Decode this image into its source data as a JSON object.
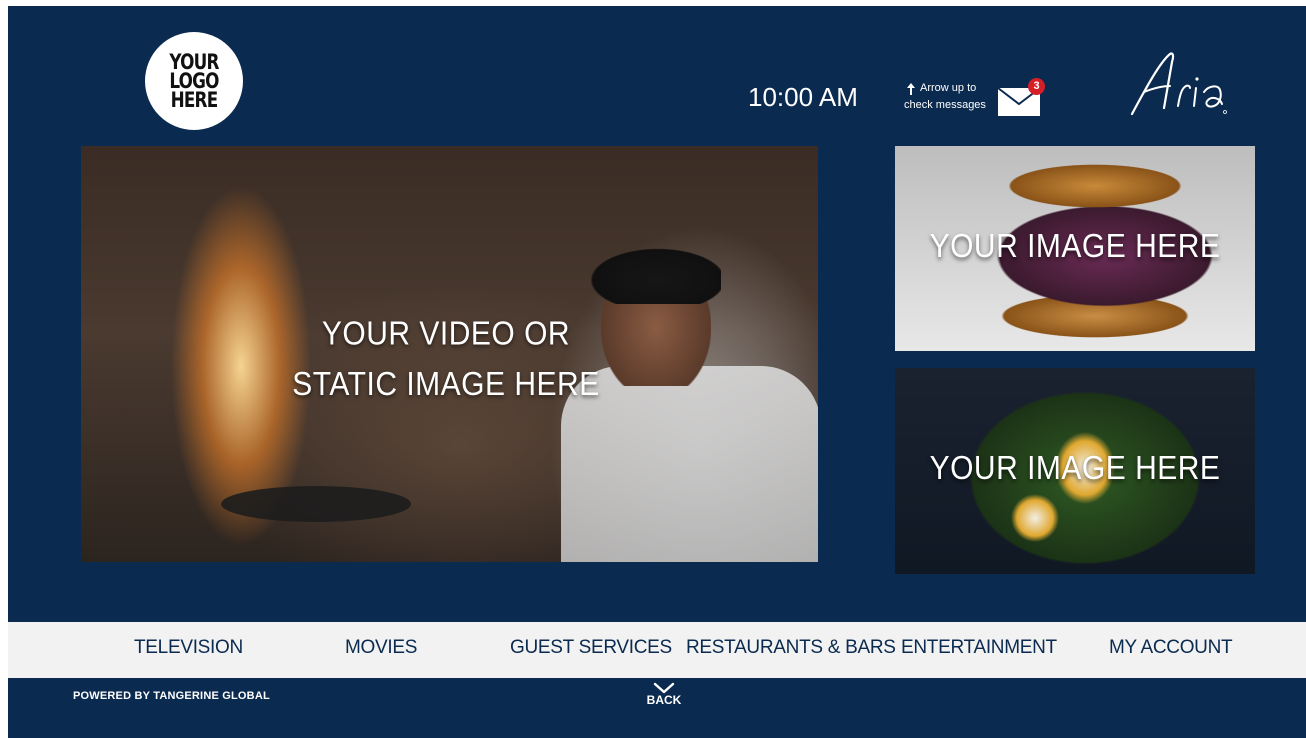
{
  "header": {
    "logo_text": "YOUR LOGO HERE",
    "time": "10:00 AM",
    "message_hint_line1": "Arrow up to",
    "message_hint_line2": "check messages",
    "message_count": "3",
    "brand": "Aria"
  },
  "main": {
    "hero_text": "YOUR VIDEO OR STATIC IMAGE HERE",
    "side_image_1_text": "YOUR IMAGE HERE",
    "side_image_2_text": "YOUR IMAGE HERE"
  },
  "nav": {
    "items": [
      {
        "label": "TELEVISION"
      },
      {
        "label": "MOVIES"
      },
      {
        "label": "GUEST SERVICES"
      },
      {
        "label": "RESTAURANTS & BARS"
      },
      {
        "label": "ENTERTAINMENT"
      },
      {
        "label": "MY ACCOUNT"
      }
    ]
  },
  "footer": {
    "powered_by": "POWERED BY TANGERINE GLOBAL",
    "back_label": "BACK"
  },
  "icons": {
    "arrow": "arrow-up-icon",
    "mail": "envelope-icon",
    "back": "chevron-down-icon"
  },
  "colors": {
    "background": "#0b2a4f",
    "nav_bar": "#f2f2f2",
    "nav_text": "#0b2a4f",
    "badge": "#d41f26"
  }
}
